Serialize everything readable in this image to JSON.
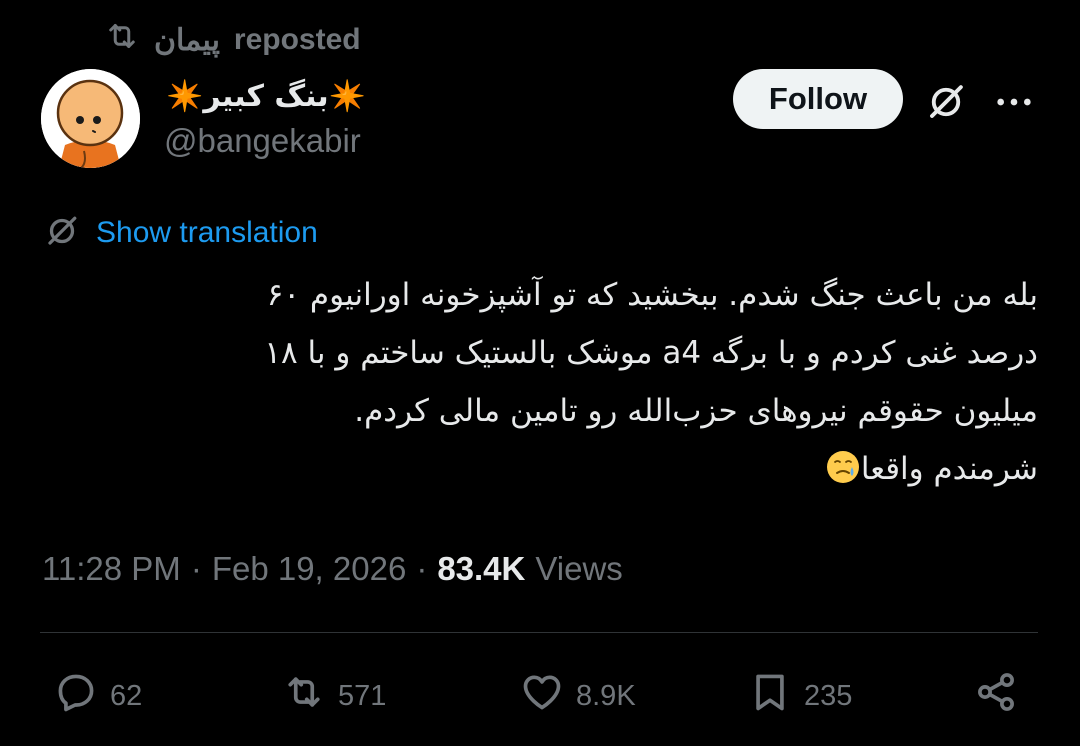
{
  "repost": {
    "reposter": "پیمان",
    "label": "reposted",
    "icon": "repost-icon"
  },
  "author": {
    "display_name": "✴️بنگ کبیر✴️",
    "handle": "@bangekabir",
    "avatar_icon": "cartoon-avatar"
  },
  "header_actions": {
    "follow_label": "Follow",
    "grok_icon": "grok-icon",
    "more_icon": "more-dots-icon"
  },
  "translation": {
    "link_text": "Show translation",
    "icon": "grok-icon"
  },
  "tweet": {
    "lines": [
      "بله من باعث جنگ شدم. ببخشید که تو آشپزخونه اورانیوم ۶۰",
      "درصد غنی کردم و با برگه a4 موشک بالستیک ساختم و با ۱۸",
      "میلیون حقوقم نیروهای حزب‌الله رو تامین مالی کردم.",
      "شرمندم واقعا"
    ],
    "emoji": "face-holding-back-tears"
  },
  "meta": {
    "time": "11:28 PM",
    "separator": "·",
    "date": "Feb 19, 2026",
    "views_count": "83.4K",
    "views_label": "Views"
  },
  "actions": {
    "replies": "62",
    "reposts": "571",
    "likes": "8.9K",
    "bookmarks": "235"
  },
  "colors": {
    "background": "#000000",
    "text": "#e7e9ea",
    "muted": "#71767b",
    "link": "#1d9bf0",
    "divider": "#2f3336",
    "follow_bg": "#eff3f4"
  }
}
